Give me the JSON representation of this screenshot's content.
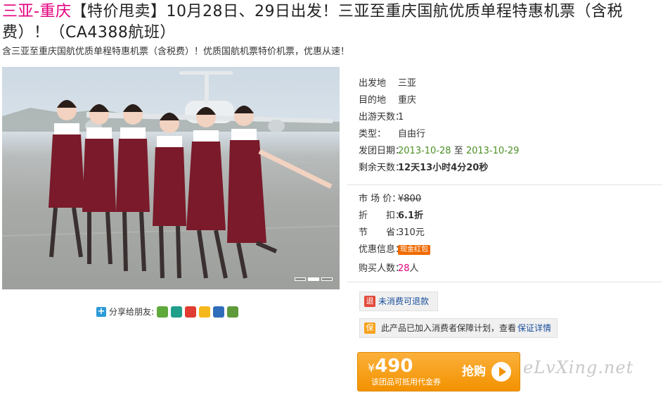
{
  "title": {
    "route": "三亚-重庆",
    "text": "【特价甩卖】10月28日、29日出发！三亚至重庆国航优质单程特惠机票（含税费）！（CA4388航班）"
  },
  "subtitle": "含三亚至重庆国航优质单程特惠机票（含税费）！优质国航机票特价机票，优惠从速！",
  "share": {
    "label": "分享给朋友:",
    "icons": [
      "kaixin-icon",
      "douban-icon",
      "weibo-icon",
      "qzone-icon",
      "renren-icon",
      "sina-icon"
    ]
  },
  "carousel": {
    "total": 3,
    "active": 1
  },
  "info": {
    "departure_label": "出发地",
    "departure": "三亚",
    "destination_label": "目的地",
    "destination": "重庆",
    "days_label": "出游天数：",
    "days": "1",
    "type_label": "类型：",
    "type": "自由行",
    "date_label": "发团日期：",
    "date_from": "2013-10-28",
    "date_to_word": "至",
    "date_to": "2013-10-29",
    "remaining_label": "剩余天数：",
    "remaining": "12天13小时4分20秒"
  },
  "pricing": {
    "market_label": "市 场 价：",
    "market_price": "¥800",
    "discount_label": "折　　扣：",
    "discount": "6.1折",
    "save_label": "节　　省：",
    "save": "310元",
    "promo_label": "优惠信息：",
    "promo_badge": "现金红包",
    "buyers_label": "购买人数：",
    "buyers_count": "28",
    "buyers_unit": "人"
  },
  "refund": {
    "icon": "退",
    "text": "未消费可退款"
  },
  "guarantee": {
    "icon": "保",
    "text": "此产品已加入消费者保障计划，查看",
    "link": "保证详情"
  },
  "buy": {
    "currency": "¥",
    "price": "490",
    "note": "该团品可抵用代金券",
    "cta": "抢购"
  },
  "watermark": "eLvXing.net",
  "colors": {
    "accent": "#e4007f",
    "button": "#f39200",
    "date": "#4b8f23",
    "link": "#1a4f9c"
  }
}
